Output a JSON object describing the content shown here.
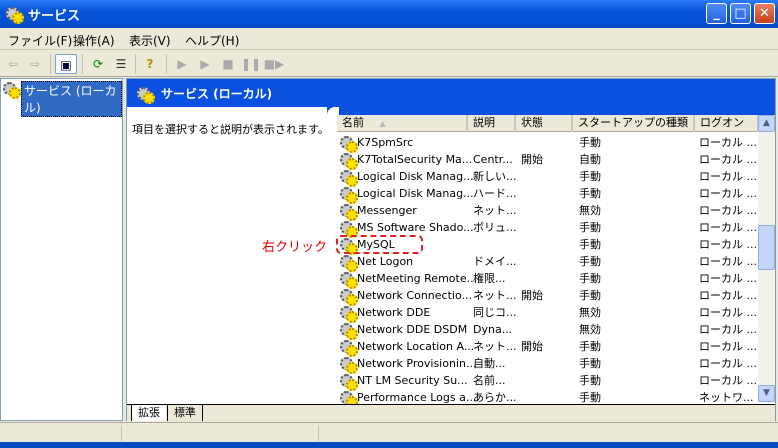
{
  "window": {
    "title": "サービス",
    "icon": "services-gear-icon"
  },
  "menu": [
    "ファイル(F)",
    "操作(A)",
    "表示(V)",
    "ヘルプ(H)"
  ],
  "toolbar": {
    "icons": [
      "back-icon",
      "forward-icon",
      "show-hide-tree-icon",
      "refresh-icon",
      "export-list-icon",
      "help-icon",
      "start-icon",
      "start-alt-icon",
      "stop-icon",
      "pause-icon",
      "restart-icon"
    ]
  },
  "tree": {
    "selected": "サービス (ローカル)"
  },
  "pane": {
    "title": "サービス (ローカル)",
    "description": "項目を選択すると説明が表示されます。"
  },
  "columns": [
    "名前",
    "説明",
    "状態",
    "スタートアップの種類",
    "ログオン"
  ],
  "sort_indicator": "▲",
  "rows": [
    [
      "K7SpmSrc",
      "",
      "",
      "手動",
      "ローカル ..."
    ],
    [
      "K7TotalSecurity Ma...",
      "Centr...",
      "開始",
      "自動",
      "ローカル ..."
    ],
    [
      "Logical Disk Manag...",
      "新しい...",
      "",
      "手動",
      "ローカル ..."
    ],
    [
      "Logical Disk Manag...",
      "ハード...",
      "",
      "手動",
      "ローカル ..."
    ],
    [
      "Messenger",
      "ネット...",
      "",
      "無効",
      "ローカル ..."
    ],
    [
      "MS Software Shado...",
      "ボリュ...",
      "",
      "手動",
      "ローカル ..."
    ],
    [
      "MySQL",
      "",
      "",
      "手動",
      "ローカル ..."
    ],
    [
      "Net Logon",
      "ドメイ...",
      "",
      "手動",
      "ローカル ..."
    ],
    [
      "NetMeeting Remote...",
      "権限...",
      "",
      "手動",
      "ローカル ..."
    ],
    [
      "Network Connectio...",
      "ネット...",
      "開始",
      "手動",
      "ローカル ..."
    ],
    [
      "Network DDE",
      "同じコ...",
      "",
      "無効",
      "ローカル ..."
    ],
    [
      "Network DDE DSDM",
      "Dyna...",
      "",
      "無効",
      "ローカル ..."
    ],
    [
      "Network Location A...",
      "ネット...",
      "開始",
      "手動",
      "ローカル ..."
    ],
    [
      "Network Provisionin...",
      "自動...",
      "",
      "手動",
      "ローカル ..."
    ],
    [
      "NT LM Security Su...",
      "名前...",
      "",
      "手動",
      "ローカル ..."
    ],
    [
      "Performance Logs a...",
      "あらか...",
      "",
      "手動",
      "ネットワ..."
    ]
  ],
  "tabs": [
    "拡張",
    "標準"
  ],
  "annotation": {
    "text": "右クリック",
    "color": "#e00000"
  }
}
